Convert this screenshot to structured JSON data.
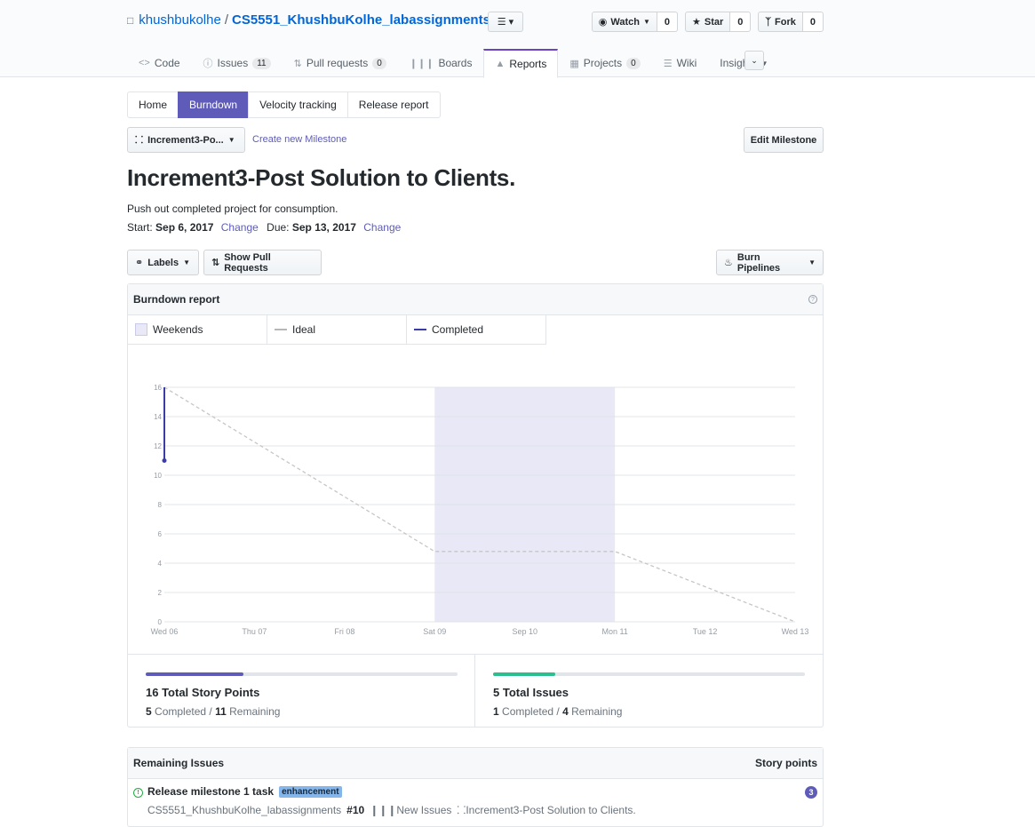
{
  "repo": {
    "owner": "khushbukolhe",
    "separator": "/",
    "name": "CS5551_KhushbuKolhe_labassignments"
  },
  "actions": {
    "watch": {
      "label": "Watch",
      "count": "0"
    },
    "star": {
      "label": "Star",
      "count": "0"
    },
    "fork": {
      "label": "Fork",
      "count": "0"
    }
  },
  "nav": {
    "code": "Code",
    "issues": "Issues",
    "issues_count": "11",
    "pulls": "Pull requests",
    "pulls_count": "0",
    "boards": "Boards",
    "reports": "Reports",
    "projects": "Projects",
    "projects_count": "0",
    "wiki": "Wiki",
    "insights": "Insights"
  },
  "subnav": {
    "home": "Home",
    "burndown": "Burndown",
    "velocity": "Velocity tracking",
    "release": "Release report"
  },
  "milestone_select": "Increment3-Po...",
  "create_milestone": "Create new Milestone",
  "edit_milestone": "Edit Milestone",
  "milestone": {
    "title": "Increment3-Post Solution to Clients.",
    "description": "Push out completed project for consumption.",
    "start_label": "Start:",
    "start": "Sep 6, 2017",
    "due_label": "Due:",
    "due": "Sep 13, 2017",
    "change": "Change"
  },
  "filters": {
    "labels": "Labels",
    "pulls": "Show Pull Requests",
    "pipelines": "Burn Pipelines"
  },
  "report": {
    "title": "Burndown report",
    "legend": {
      "weekends": "Weekends",
      "ideal": "Ideal",
      "completed": "Completed"
    }
  },
  "chart_data": {
    "type": "line",
    "x": [
      "Wed 06",
      "Thu 07",
      "Fri 08",
      "Sat 09",
      "Sep 10",
      "Mon 11",
      "Tue 12",
      "Wed 13"
    ],
    "ylim": [
      0,
      16
    ],
    "yticks": [
      0,
      2,
      4,
      6,
      8,
      10,
      12,
      14,
      16
    ],
    "weekend_band": [
      "Sat 09",
      "Mon 11"
    ],
    "series": [
      {
        "name": "Ideal",
        "points": [
          [
            0,
            16
          ],
          [
            3,
            4.8
          ],
          [
            5,
            4.8
          ],
          [
            7,
            0
          ]
        ],
        "color": "#c6c6c6",
        "dashed": true
      },
      {
        "name": "Completed",
        "points": [
          [
            0,
            16
          ],
          [
            0,
            11
          ]
        ],
        "color": "#3c3ca8"
      }
    ],
    "grid": true
  },
  "stats": {
    "points": {
      "title": "16 Total Story Points",
      "completed": "5",
      "completed_label": "Completed /",
      "remaining": "11",
      "remaining_label": "Remaining",
      "fraction": 0.3125,
      "color": "#5e5cb8"
    },
    "issues": {
      "title": "5 Total Issues",
      "completed": "1",
      "completed_label": "Completed /",
      "remaining": "4",
      "remaining_label": "Remaining",
      "fraction": 0.2,
      "color": "#2cbe8f"
    }
  },
  "remaining": {
    "title": "Remaining Issues",
    "points_header": "Story points",
    "issues": [
      {
        "title": "Release milestone 1 task",
        "label": "enhancement",
        "repo": "CS5551_KhushbuKolhe_labassignments",
        "number": "#10",
        "pipeline": "New Issues",
        "milestone": "Increment3-Post Solution to Clients.",
        "points": "3"
      }
    ]
  }
}
